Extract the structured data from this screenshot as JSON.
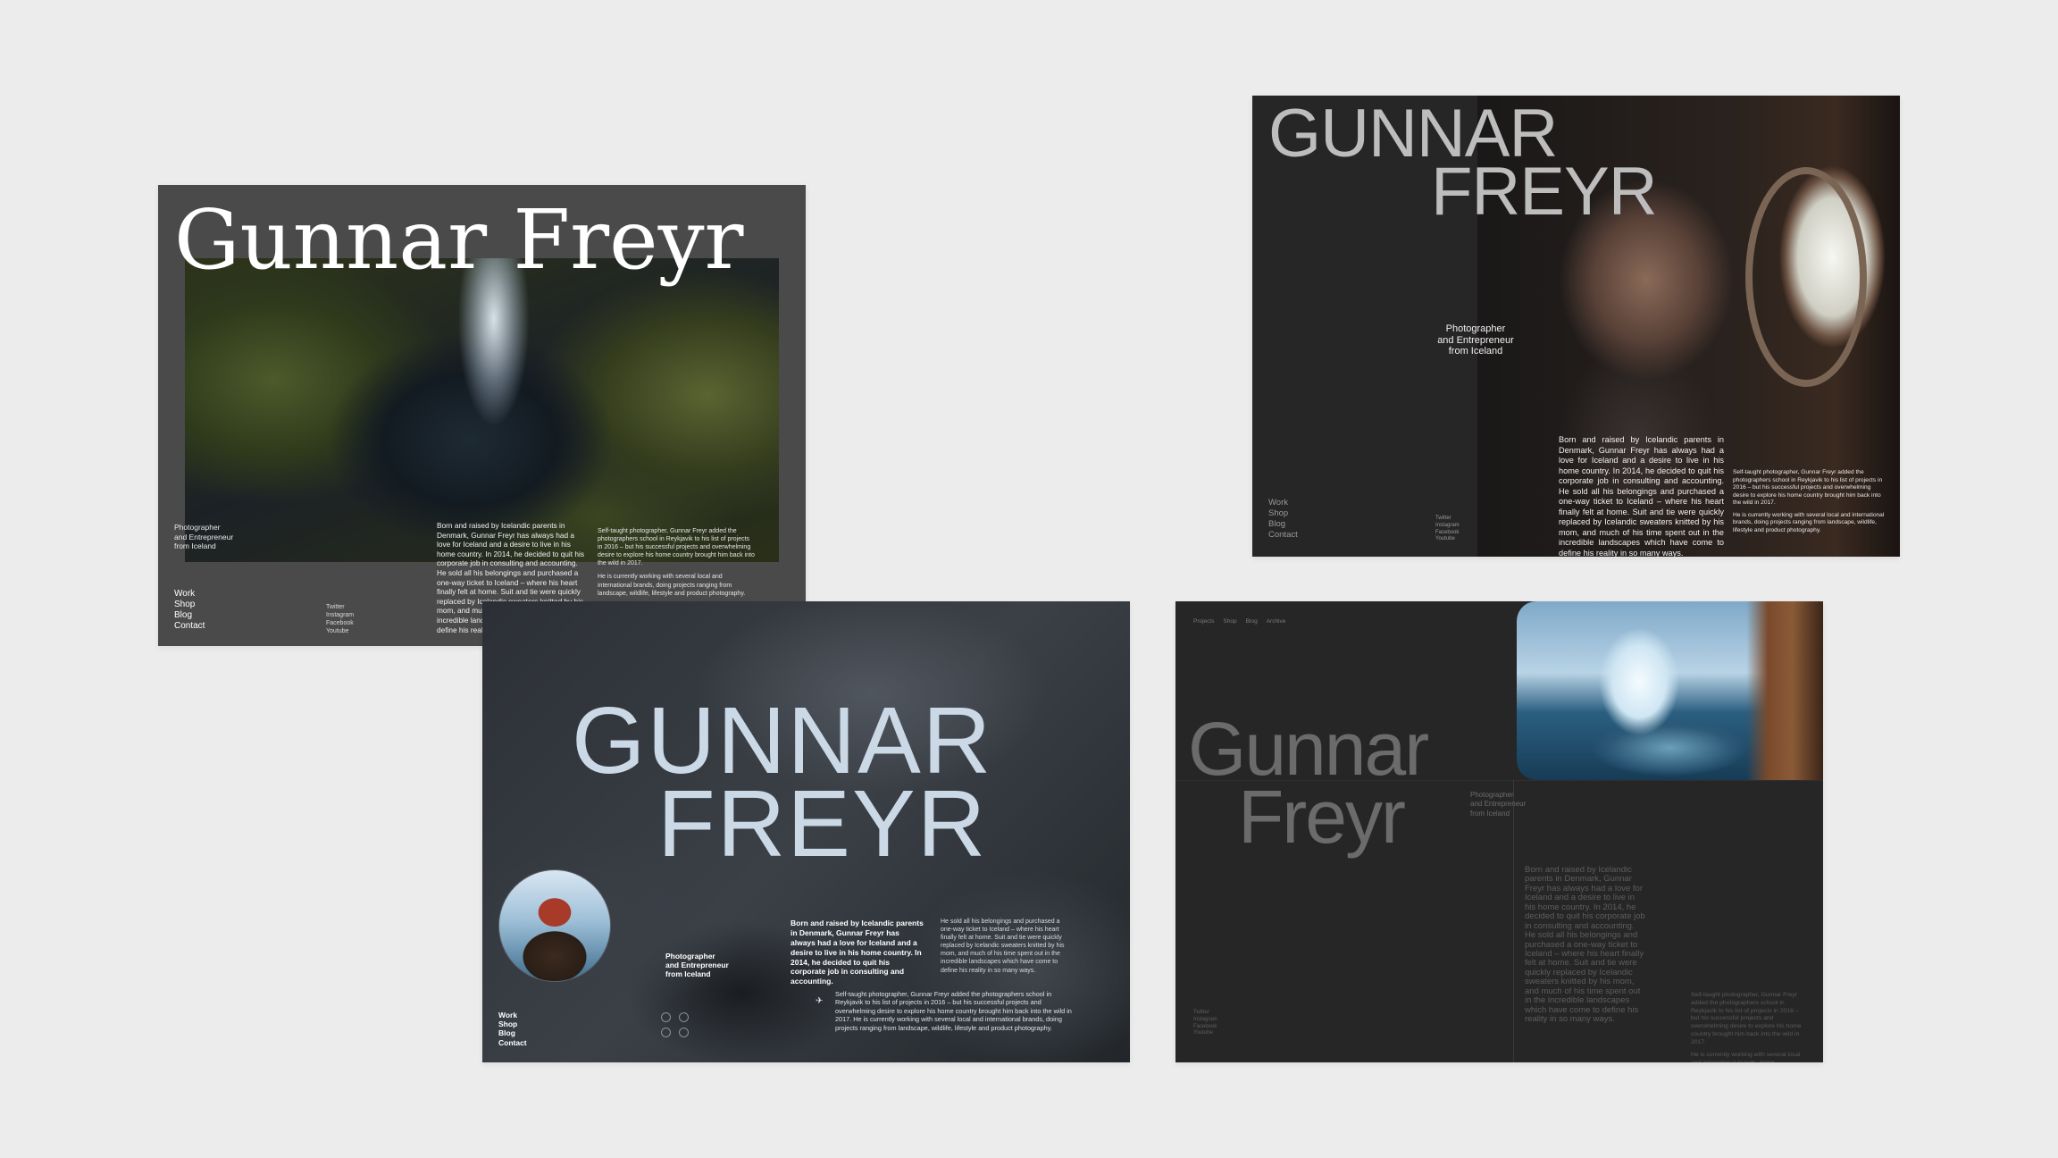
{
  "card_a": {
    "title": "Gunnar Freyr",
    "tagline": [
      "Photographer",
      "and Entrepreneur",
      "from Iceland"
    ],
    "nav": [
      "Work",
      "Shop",
      "Blog",
      "Contact"
    ],
    "social": [
      "Twitter",
      "Instagram",
      "Facebook",
      "Youtube"
    ],
    "bio": "Born and raised by Icelandic parents in Denmark, Gunnar Freyr has always had a love for Iceland and a desire to live in his home country. In 2014, he decided to quit his corporate job in consulting and accounting. He sold all his belongings and purchased a one-way ticket to Iceland – where his heart finally felt at home. Suit and tie were quickly replaced by Icelandic sweaters knitted by his mom, and much of his time spent out in the incredible landscapes which have come to define his reality in so many ways.",
    "bio2": "Self-taught photographer, Gunnar Freyr added the photographers school in Reykjavik to his list of projects in 2016 – but his successful projects and overwhelming desire to explore his home country brought him back into the wild in 2017.",
    "bio3": "He is currently working with several local and international brands, doing projects ranging from landscape, wildlife, lifestyle and product photography."
  },
  "card_b": {
    "title_line1": "GUNNAR",
    "title_line2": "FREYR",
    "tagline": [
      "Photographer",
      "and Entrepreneur",
      "from Iceland"
    ],
    "nav": [
      "Work",
      "Shop",
      "Blog",
      "Contact"
    ],
    "social": [
      "Twitter",
      "Instagram",
      "Facebook",
      "Youtube"
    ],
    "bio": "Born and raised by Icelandic parents in Denmark, Gunnar Freyr has always had a love for Iceland and a desire to live in his home country. In 2014, he decided to quit his corporate job in consulting and accounting. He sold all his belongings and purchased a one-way ticket to Iceland – where his heart finally felt at home. Suit and tie were quickly replaced by Icelandic sweaters knitted by his mom, and much of his time spent out in the incredible landscapes which have come to define his reality in so many ways.",
    "bio2": "Self-taught photographer, Gunnar Freyr added the photographers school in Reykjavik to his list of projects in 2016 – but his successful projects and overwhelming desire to explore his home country brought him back into the wild in 2017.",
    "bio3": "He is currently working with several local and international brands, doing projects ranging from landscape, wildlife, lifestyle and product photography."
  },
  "card_c": {
    "title_line1": "GUNNAR",
    "title_line2": "FREYR",
    "tagline": [
      "Photographer",
      "and Entrepreneur",
      "from Iceland"
    ],
    "nav": [
      "Work",
      "Shop",
      "Blog",
      "Contact"
    ],
    "bio": "Born and raised by Icelandic parents in Denmark, Gunnar Freyr has always had a love for Iceland and a desire to live in his home country. In 2014, he decided to quit his corporate job in consulting and accounting.",
    "bio_right": "He sold all his belongings and purchased a one-way ticket to Iceland – where his heart finally felt at home. Suit and tie were quickly replaced by Icelandic sweaters knitted by his mom, and much of his time spent out in the incredible landscapes which have come to define his reality in so many ways.",
    "bio2": "Self-taught photographer, Gunnar Freyr added the photographers school in Reykjavik to his list of projects in 2016 – but his successful projects and overwhelming desire to explore his home country brought him back into the wild in 2017. He is currently working with several local and international brands, doing projects ranging from landscape, wildlife, lifestyle and product photography."
  },
  "card_d": {
    "topnav": [
      "Projects",
      "Shop",
      "Blog",
      "Archive"
    ],
    "title_line1": "Gunnar",
    "title_line2": "Freyr",
    "tagline": [
      "Photographer",
      "and Entrepreneur",
      "from Iceland"
    ],
    "social": [
      "Twitter",
      "Instagram",
      "Facebook",
      "Youtube"
    ],
    "bio": "Born and raised by Icelandic parents in Denmark, Gunnar Freyr has always had a love for Iceland and a desire to live in his home country. In 2014, he decided to quit his corporate job in consulting and accounting. He sold all his belongings and purchased a one-way ticket to Iceland – where his heart finally felt at home. Suit and tie were quickly replaced by Icelandic sweaters knitted by his mom, and much of his time spent out in the incredible landscapes which have come to define his reality in so many ways.",
    "bio2": "Self-taught photographer, Gunnar Freyr added the photographers school in Reykjavik to his list of projects in 2016 – but his successful projects and overwhelming desire to explore his home country brought him back into the wild in 2017.",
    "bio3": "He is currently working with several local and international brands, doing"
  }
}
